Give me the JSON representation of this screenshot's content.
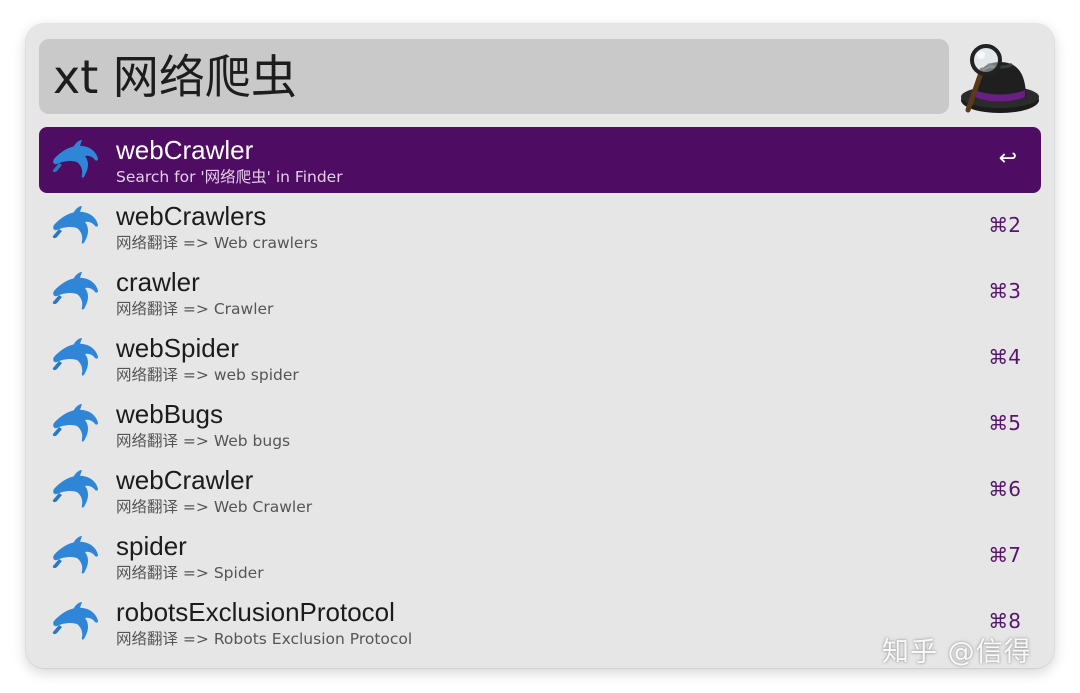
{
  "search": {
    "query": "xt 网络爬虫"
  },
  "app_icon": "alfred-hat-icon",
  "results": [
    {
      "title": "webCrawler",
      "subtitle": "Search for '网络爬虫' in Finder",
      "shortcut": "↩",
      "icon": "dolphin-icon",
      "selected": true
    },
    {
      "title": "webCrawlers",
      "subtitle": "网络翻译 => Web crawlers",
      "shortcut": "⌘2",
      "icon": "dolphin-icon"
    },
    {
      "title": "crawler",
      "subtitle": "网络翻译 => Crawler",
      "shortcut": "⌘3",
      "icon": "dolphin-icon"
    },
    {
      "title": "webSpider",
      "subtitle": "网络翻译 => web spider",
      "shortcut": "⌘4",
      "icon": "dolphin-icon"
    },
    {
      "title": "webBugs",
      "subtitle": "网络翻译 => Web bugs",
      "shortcut": "⌘5",
      "icon": "dolphin-icon"
    },
    {
      "title": "webCrawler",
      "subtitle": "网络翻译 => Web Crawler",
      "shortcut": "⌘6",
      "icon": "dolphin-icon"
    },
    {
      "title": "spider",
      "subtitle": "网络翻译 => Spider",
      "shortcut": "⌘7",
      "icon": "dolphin-icon"
    },
    {
      "title": "robotsExclusionProtocol",
      "subtitle": "网络翻译 => Robots Exclusion Protocol",
      "shortcut": "⌘8",
      "icon": "dolphin-icon"
    }
  ],
  "watermark": "知乎 @信得",
  "colors": {
    "selection": "#4f0c63",
    "shortcut": "#58156e",
    "dolphin": "#2f86d6",
    "window_bg": "#e6e6e6",
    "search_bg": "#c9c9c9"
  }
}
